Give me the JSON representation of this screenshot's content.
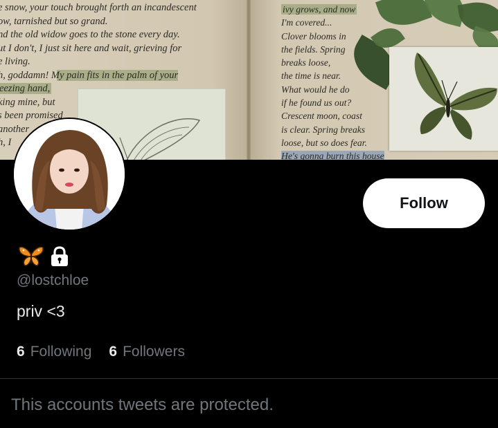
{
  "banner": {
    "left_lines": [
      "e snow, your touch brought forth an incandescent",
      "ow, tarnished but so grand.",
      "nd the old widow goes to the stone every day.",
      "ut I don't, I just sit here and wait, grieving for",
      "e living.",
      "h, goddamn! My pain fits in the palm of your",
      "eezing       hand,",
      "king  mine,  but",
      "s been promised",
      " another",
      "h,  I"
    ],
    "right_lines": [
      "ivy grows, and now",
      "I'm covered...",
      "Clover blooms in",
      "the fields. Spring",
      "breaks loose,",
      "the time is near.",
      "What would he do",
      "if he found us out?",
      "Crescent moon, coast",
      "is clear. Spring breaks",
      "loose, but so does fear.",
      "He's gonna burn this house"
    ]
  },
  "profile": {
    "handle": "@lostchloe",
    "bio": "priv <3",
    "name_icons": [
      "butterfly-icon",
      "lock-icon"
    ],
    "following_count": "6",
    "following_label": "Following",
    "followers_count": "6",
    "followers_label": "Followers"
  },
  "actions": {
    "follow_label": "Follow"
  },
  "notice": {
    "protected_text": "This accounts tweets are protected."
  },
  "colors": {
    "background": "#000000",
    "text_primary": "#e7e9ea",
    "text_secondary": "#71767b",
    "button_bg": "#ffffff",
    "butterfly": "#f08c1a"
  }
}
